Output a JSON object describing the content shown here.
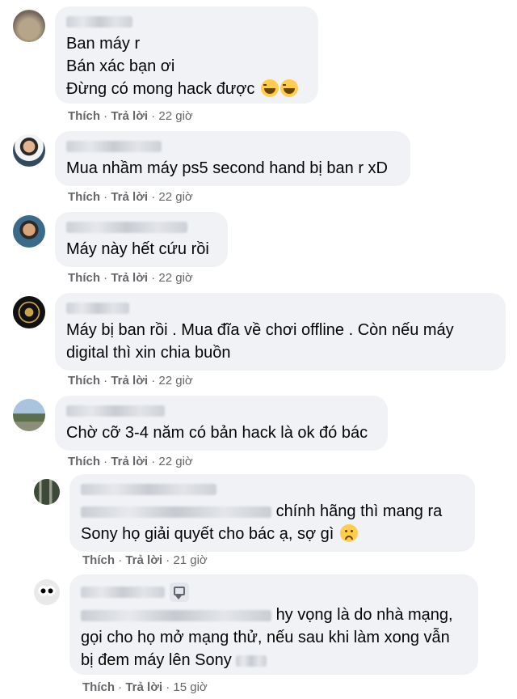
{
  "comments": [
    {
      "lines": [
        "Ban máy r",
        "Bán xác bạn ơi",
        "Đừng có mong hack được"
      ],
      "like": "Thích",
      "reply": "Trả lời",
      "time": "22 giờ"
    },
    {
      "lines": [
        "Mua nhầm máy ps5 second hand bị ban r xD"
      ],
      "like": "Thích",
      "reply": "Trả lời",
      "time": "22 giờ"
    },
    {
      "lines": [
        "Máy này hết cứu rồi"
      ],
      "like": "Thích",
      "reply": "Trả lời",
      "time": "22 giờ"
    },
    {
      "lines": [
        "Máy bị ban rồi . Mua đĩa về chơi offline . Còn nếu máy",
        "digital thì xin chia buồn"
      ],
      "like": "Thích",
      "reply": "Trả lời",
      "time": "22 giờ"
    },
    {
      "lines": [
        "Chờ cỡ 3-4 năm có bản hack là ok đó bác"
      ],
      "like": "Thích",
      "reply": "Trả lời",
      "time": "22 giờ"
    },
    {
      "lines": [
        "chính hãng thì mang ra",
        "Sony họ giải quyết cho bác ạ, sợ gì"
      ],
      "like": "Thích",
      "reply": "Trả lời",
      "time": "21 giờ"
    },
    {
      "lines": [
        "hy vọng là do nhà mạng,",
        "gọi cho họ mở mạng thử, nếu sau khi làm xong vẫn",
        "bị đem máy lên Sony"
      ],
      "like": "Thích",
      "reply": "Trả lời",
      "time": "15 giờ"
    }
  ],
  "emojis": {
    "laugh": "rolling-on-floor-laughing",
    "sad": "confused-face"
  },
  "colors": {
    "bubble": "#f0f2f5",
    "meta": "#65676b",
    "text": "#050505"
  }
}
